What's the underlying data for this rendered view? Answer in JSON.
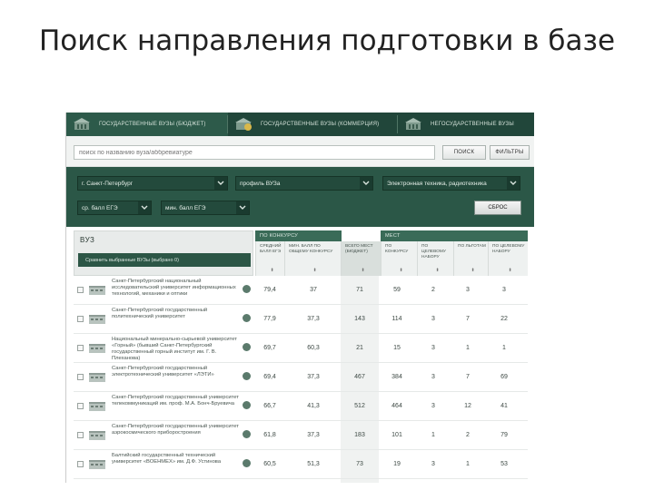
{
  "slide": {
    "title": "Поиск направления подготовки в базе"
  },
  "tabs": [
    {
      "label": "ГОСУДАРСТВЕННЫЕ ВУЗЫ (БЮДЖЕТ)",
      "icon": "building-icon"
    },
    {
      "label": "ГОСУДАРСТВЕННЫЕ ВУЗЫ (КОММЕРЦИЯ)",
      "icon": "building-coin-icon"
    },
    {
      "label": "НЕГОСУДАРСТВЕННЫЕ ВУЗЫ",
      "icon": "building-icon"
    }
  ],
  "search": {
    "placeholder": "поиск по названию вуза/аббревиатуре",
    "search_label": "ПОИСК",
    "filters_label": "ФИЛЬТРЫ"
  },
  "filters": {
    "city": "г. Санкт-Петербург",
    "profile": "профиль ВУЗа",
    "direction": "Электронная техника, радиотехника",
    "avg_score": "ср. балл ЕГЭ",
    "min_score": "мин. балл ЕГЭ",
    "reset_label": "СБРОС"
  },
  "results": {
    "vuz_label": "ВУЗ",
    "compare_label": "Сравнить выбранные ВУЗы (выбрано 0)",
    "group_contest": "ПО КОНКУРСУ",
    "group_places": "МЕСТ",
    "columns": [
      "СРЕДНИЙ БАЛЛ ЕГЭ",
      "МИН. БАЛЛ ПО ОБЩЕМУ КОНКУРСУ",
      "ВСЕГО МЕСТ (БЮДЖЕТ)",
      "ПО КОНКУРСУ",
      "ПО ЦЕЛЕВОМУ НАБОРУ",
      "ПО ЛЬГОТАМ",
      "ПО ЦЕЛЕВОМУ НАБОРУ"
    ],
    "rows": [
      {
        "name": "Санкт-Петербургский национальный исследовательский университет информационных технологий, механики и оптики",
        "values": [
          "79,4",
          "37",
          "71",
          "59",
          "2",
          "3",
          "3"
        ]
      },
      {
        "name": "Санкт-Петербургский государственный политехнический университет",
        "values": [
          "77,9",
          "37,3",
          "143",
          "114",
          "3",
          "7",
          "22"
        ]
      },
      {
        "name": "Национальный минерально-сырьевой университет «Горный» (бывший Санкт-Петербургский государственный горный институт им. Г. В. Плеханова)",
        "values": [
          "69,7",
          "60,3",
          "21",
          "15",
          "3",
          "1",
          "1"
        ]
      },
      {
        "name": "Санкт-Петербургский государственный электротехнический университет «ЛЭТИ»",
        "values": [
          "69,4",
          "37,3",
          "467",
          "384",
          "3",
          "7",
          "69"
        ]
      },
      {
        "name": "Санкт-Петербургский государственный университет телекоммуникаций им. проф. М.А. Бонч-Бруевича",
        "values": [
          "66,7",
          "41,3",
          "512",
          "464",
          "3",
          "12",
          "41"
        ]
      },
      {
        "name": "Санкт-Петербургский государственный университет аэрокосмического приборостроения",
        "values": [
          "61,8",
          "37,3",
          "183",
          "101",
          "1",
          "2",
          "79"
        ]
      },
      {
        "name": "Балтийский государственный технический университет «ВОЕНМЕХ» им. Д.Ф. Устинова",
        "values": [
          "60,5",
          "51,3",
          "73",
          "19",
          "3",
          "1",
          "53"
        ]
      }
    ]
  }
}
